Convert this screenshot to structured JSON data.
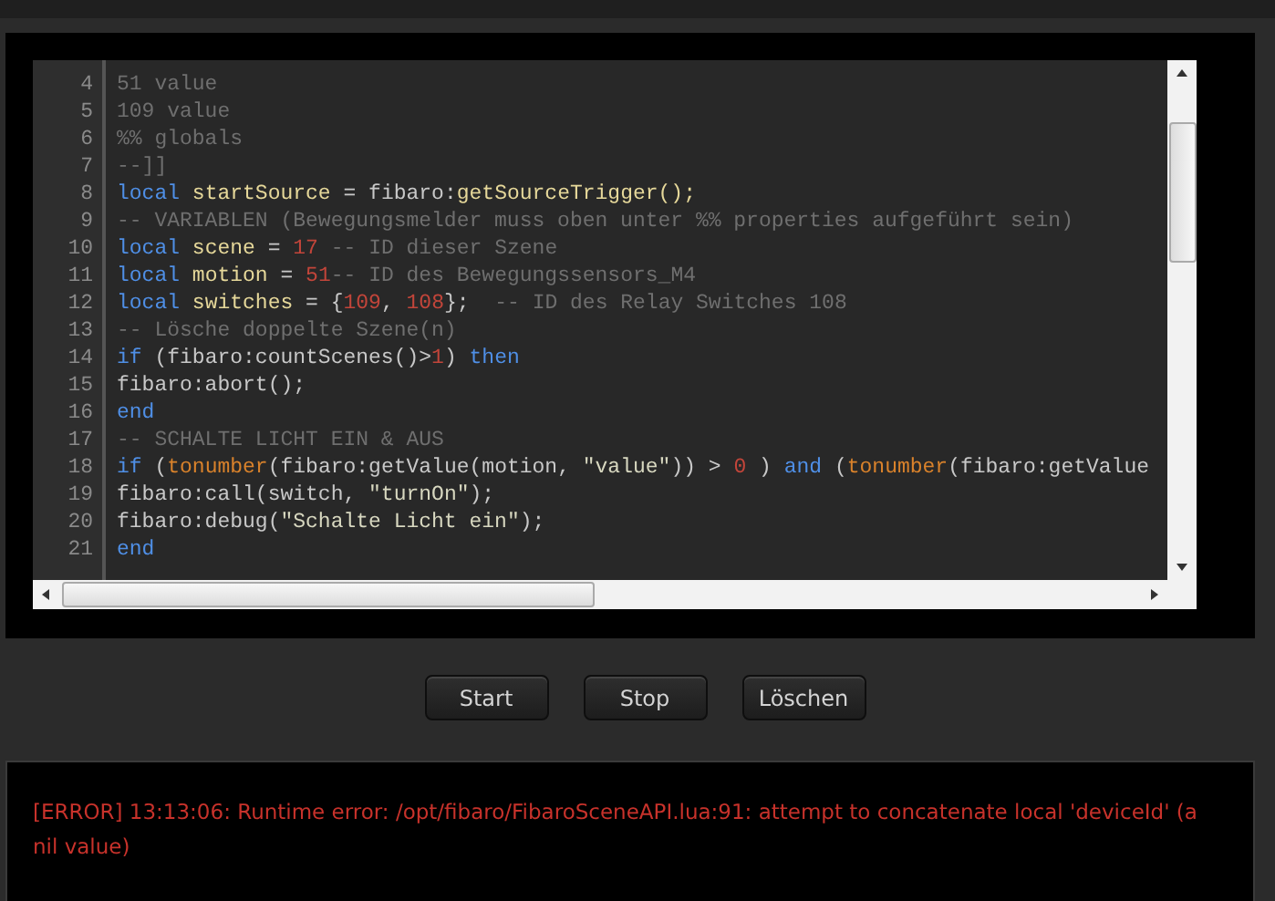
{
  "editor": {
    "lines": [
      {
        "number": "4",
        "tokens": [
          {
            "kind": "comment",
            "text": "51 value"
          }
        ]
      },
      {
        "number": "5",
        "tokens": [
          {
            "kind": "comment",
            "text": "109 value"
          }
        ]
      },
      {
        "number": "6",
        "tokens": [
          {
            "kind": "comment",
            "text": "%% globals"
          }
        ]
      },
      {
        "number": "7",
        "tokens": [
          {
            "kind": "comment",
            "text": "--]]"
          }
        ]
      },
      {
        "number": "8",
        "tokens": [
          {
            "kind": "keyword",
            "text": "local"
          },
          {
            "kind": "variable",
            "text": " startSource"
          },
          {
            "kind": "plain",
            "text": " = fibaro:"
          },
          {
            "kind": "variable",
            "text": "getSourceTrigger();"
          }
        ]
      },
      {
        "number": "9",
        "tokens": [
          {
            "kind": "comment",
            "text": "-- VARIABLEN (Bewegungsmelder muss oben unter %% properties aufgeführt sein)"
          }
        ]
      },
      {
        "number": "10",
        "tokens": [
          {
            "kind": "keyword",
            "text": "local"
          },
          {
            "kind": "variable",
            "text": " scene"
          },
          {
            "kind": "plain",
            "text": " = "
          },
          {
            "kind": "number",
            "text": "17"
          },
          {
            "kind": "comment",
            "text": " -- ID dieser Szene"
          }
        ]
      },
      {
        "number": "11",
        "tokens": [
          {
            "kind": "keyword",
            "text": "local"
          },
          {
            "kind": "variable",
            "text": " motion"
          },
          {
            "kind": "plain",
            "text": " = "
          },
          {
            "kind": "number",
            "text": "51"
          },
          {
            "kind": "comment",
            "text": "-- ID des Bewegungssensors_M4"
          }
        ]
      },
      {
        "number": "12",
        "tokens": [
          {
            "kind": "keyword",
            "text": "local"
          },
          {
            "kind": "variable",
            "text": " switches"
          },
          {
            "kind": "plain",
            "text": " = {"
          },
          {
            "kind": "number",
            "text": "109"
          },
          {
            "kind": "plain",
            "text": ", "
          },
          {
            "kind": "number",
            "text": "108"
          },
          {
            "kind": "plain",
            "text": "};  "
          },
          {
            "kind": "comment",
            "text": "-- ID des Relay Switches 108"
          }
        ]
      },
      {
        "number": "13",
        "tokens": [
          {
            "kind": "comment",
            "text": "-- Lösche doppelte Szene(n)"
          }
        ]
      },
      {
        "number": "14",
        "tokens": [
          {
            "kind": "keyword",
            "text": "if"
          },
          {
            "kind": "plain",
            "text": " (fibaro:countScenes()>"
          },
          {
            "kind": "number",
            "text": "1"
          },
          {
            "kind": "plain",
            "text": ") "
          },
          {
            "kind": "keyword",
            "text": "then"
          }
        ]
      },
      {
        "number": "15",
        "tokens": [
          {
            "kind": "plain",
            "text": "fibaro:abort();"
          }
        ]
      },
      {
        "number": "16",
        "tokens": [
          {
            "kind": "keyword",
            "text": "end"
          }
        ]
      },
      {
        "number": "17",
        "tokens": [
          {
            "kind": "comment",
            "text": "-- SCHALTE LICHT EIN & AUS"
          }
        ]
      },
      {
        "number": "18",
        "tokens": [
          {
            "kind": "keyword",
            "text": "if"
          },
          {
            "kind": "plain",
            "text": " ("
          },
          {
            "kind": "builtin",
            "text": "tonumber"
          },
          {
            "kind": "plain",
            "text": "(fibaro:getValue(motion, "
          },
          {
            "kind": "string",
            "text": "\"value\""
          },
          {
            "kind": "plain",
            "text": ")) > "
          },
          {
            "kind": "number",
            "text": "0"
          },
          {
            "kind": "plain",
            "text": " ) "
          },
          {
            "kind": "keyword",
            "text": "and"
          },
          {
            "kind": "plain",
            "text": " ("
          },
          {
            "kind": "builtin",
            "text": "tonumber"
          },
          {
            "kind": "plain",
            "text": "(fibaro:getValue"
          }
        ]
      },
      {
        "number": "19",
        "tokens": [
          {
            "kind": "plain",
            "text": "fibaro:call(switch, "
          },
          {
            "kind": "string",
            "text": "\"turnOn\""
          },
          {
            "kind": "plain",
            "text": ");"
          }
        ]
      },
      {
        "number": "20",
        "tokens": [
          {
            "kind": "plain",
            "text": "fibaro:debug("
          },
          {
            "kind": "string",
            "text": "\"Schalte Licht ein\""
          },
          {
            "kind": "plain",
            "text": ");"
          }
        ]
      },
      {
        "number": "21",
        "tokens": [
          {
            "kind": "keyword",
            "text": "end"
          }
        ]
      }
    ]
  },
  "buttons": [
    "Start",
    "Stop",
    "Löschen"
  ],
  "console": {
    "message": "[ERROR] 13:13:06: Runtime error: /opt/fibaro/FibaroSceneAPI.lua:91: attempt to concatenate local 'deviceId' (a nil value)"
  }
}
